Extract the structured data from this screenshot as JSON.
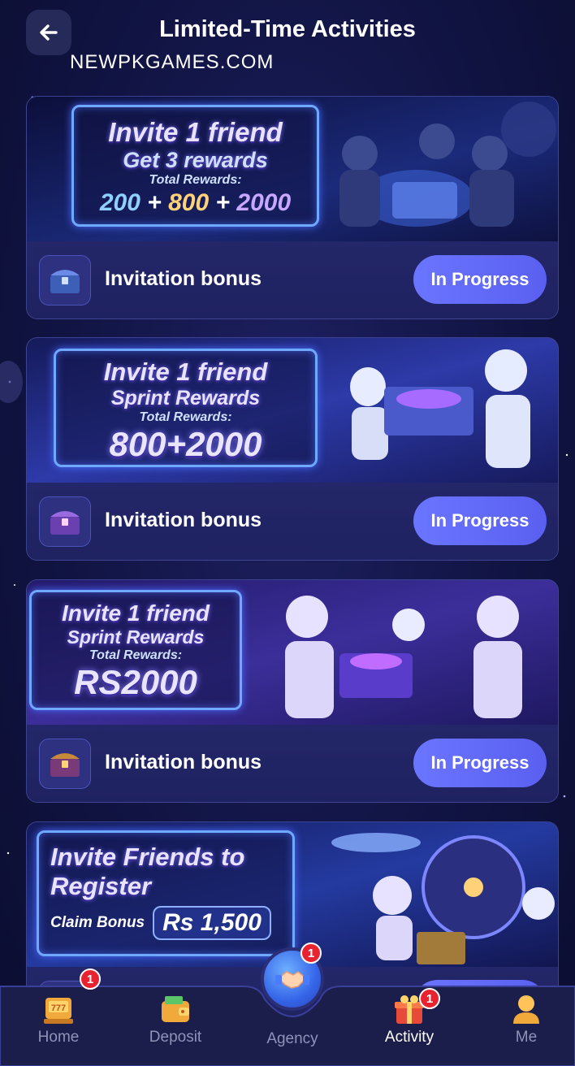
{
  "header": {
    "title": "Limited-Time Activities",
    "site_name": "NEWPKGAMES.COM"
  },
  "cards": [
    {
      "banner": {
        "line1": "Invite 1 friend",
        "line2": "Get 3 rewards",
        "line3": "Total Rewards:",
        "amount_a": "200",
        "plus_a": "+",
        "amount_b": "800",
        "plus_b": "+",
        "amount_c": "2000"
      },
      "label": "Invitation bonus",
      "status": "In Progress"
    },
    {
      "banner": {
        "line1": "Invite 1 friend",
        "line2": "Sprint Rewards",
        "line3": "Total Rewards:",
        "amount": "800+2000"
      },
      "label": "Invitation bonus",
      "status": "In Progress"
    },
    {
      "banner": {
        "line1": "Invite 1 friend",
        "line2": "Sprint Rewards",
        "line3": "Total Rewards:",
        "amount": "RS2000"
      },
      "label": "Invitation bonus",
      "status": "In Progress"
    },
    {
      "banner": {
        "line1": "Invite Friends to",
        "line2": "Register",
        "line3": "Claim Bonus",
        "amount": "Rs 1,500"
      }
    }
  ],
  "tabbar": {
    "home": "Home",
    "deposit": "Deposit",
    "agency": "Agency",
    "activity": "Activity",
    "me": "Me",
    "badge_home": "1",
    "badge_agency": "1",
    "badge_activity": "1",
    "active_tab": "Activity"
  },
  "colors": {
    "background": "#111443",
    "card": "#23266a",
    "button": "#6a75ff",
    "badge": "#e8232f"
  },
  "icons": [
    "back-arrow-icon",
    "treasure-chest-icon",
    "home-icon",
    "wallet-icon",
    "handshake-icon",
    "gift-icon",
    "user-icon"
  ]
}
